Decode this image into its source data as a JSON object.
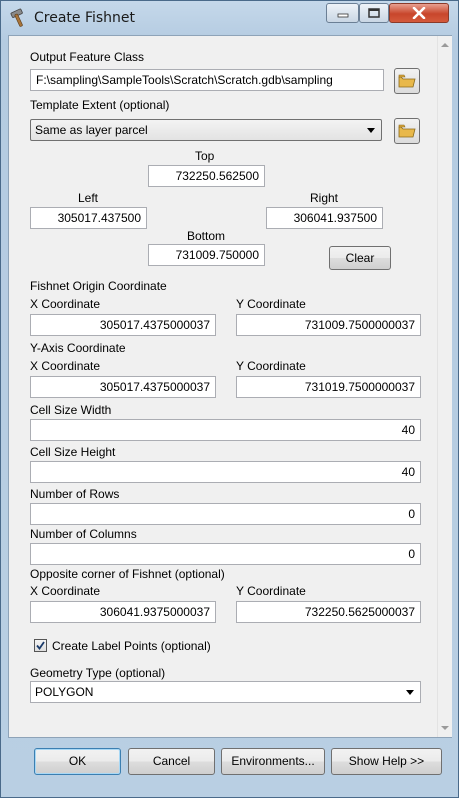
{
  "window": {
    "title": "Create Fishnet"
  },
  "output_feature_class": {
    "label": "Output Feature Class",
    "value": "F:\\sampling\\SampleTools\\Scratch\\Scratch.gdb\\sampling"
  },
  "template_extent": {
    "label": "Template Extent (optional)",
    "selected": "Same as layer parcel",
    "top_label": "Top",
    "top_value": "732250.562500",
    "left_label": "Left",
    "left_value": "305017.437500",
    "right_label": "Right",
    "right_value": "306041.937500",
    "bottom_label": "Bottom",
    "bottom_value": "731009.750000",
    "clear_label": "Clear"
  },
  "origin": {
    "label": "Fishnet Origin Coordinate",
    "x_label": "X Coordinate",
    "x_value": "305017.4375000037",
    "y_label": "Y Coordinate",
    "y_value": "731009.7500000037"
  },
  "y_axis": {
    "label": "Y-Axis Coordinate",
    "x_label": "X Coordinate",
    "x_value": "305017.4375000037",
    "y_label": "Y Coordinate",
    "y_value": "731019.7500000037"
  },
  "cell_width": {
    "label": "Cell Size Width",
    "value": "40"
  },
  "cell_height": {
    "label": "Cell Size Height",
    "value": "40"
  },
  "rows": {
    "label": "Number of Rows",
    "value": "0"
  },
  "columns": {
    "label": "Number of Columns",
    "value": "0"
  },
  "opposite": {
    "label": "Opposite corner of Fishnet (optional)",
    "x_label": "X Coordinate",
    "x_value": "306041.9375000037",
    "y_label": "Y Coordinate",
    "y_value": "732250.5625000037"
  },
  "label_points": {
    "label": "Create Label Points (optional)",
    "checked": true
  },
  "geometry": {
    "label": "Geometry Type (optional)",
    "selected": "POLYGON"
  },
  "buttons": {
    "ok": "OK",
    "cancel": "Cancel",
    "environments": "Environments...",
    "help": "Show Help >>"
  },
  "colors": {
    "titlebar": "#c5d8ea",
    "close_button": "#c8462c",
    "folder_icon": "#e8b84a"
  }
}
